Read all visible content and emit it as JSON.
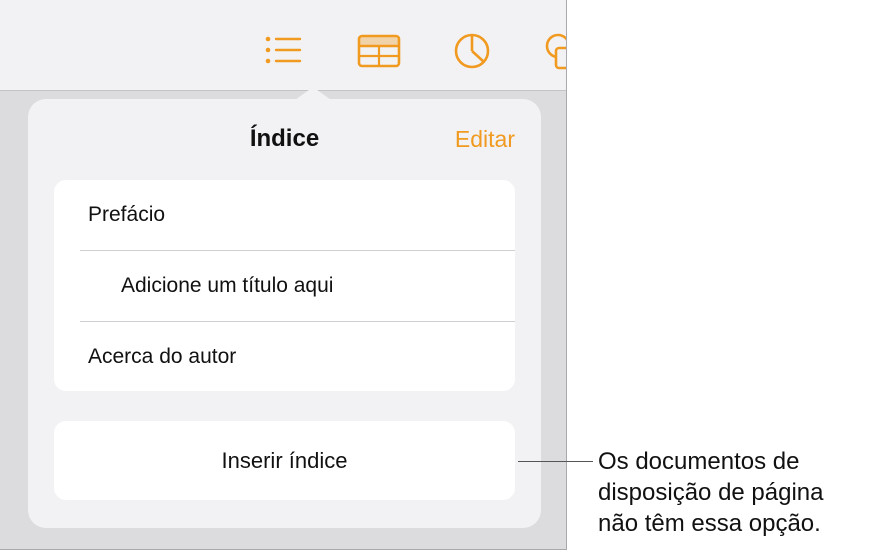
{
  "toolbar": {
    "icons": [
      "list-format-icon",
      "table-icon",
      "chart-icon",
      "shape-icon"
    ],
    "accent": "#f19a20"
  },
  "popover": {
    "title": "Índice",
    "edit_label": "Editar",
    "entries": [
      {
        "label": "Prefácio",
        "level": 1
      },
      {
        "label": "Adicione um título aqui",
        "level": 2
      },
      {
        "label": "Acerca do autor",
        "level": 1
      }
    ],
    "insert_label": "Inserir índice"
  },
  "callout": {
    "lines": [
      "Os documentos de",
      "disposição de página",
      "não têm essa opção."
    ]
  }
}
